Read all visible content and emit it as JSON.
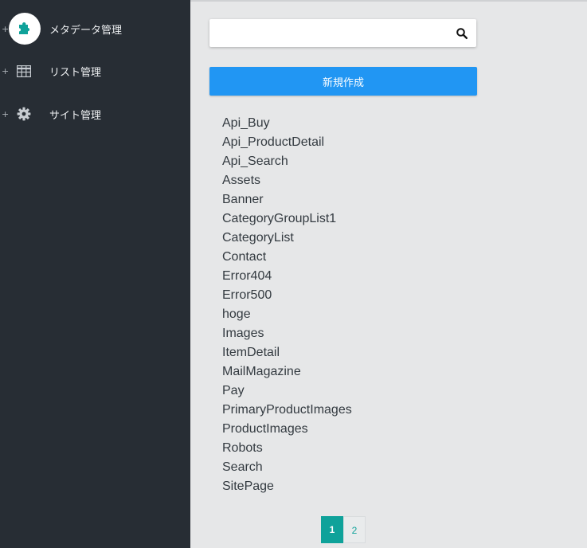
{
  "colors": {
    "sidebar_bg": "#272d34",
    "main_bg": "#e6e7e8",
    "accent_teal": "#0fa29a",
    "button_blue": "#2196f3"
  },
  "sidebar": {
    "items": [
      {
        "expander": "+",
        "icon": "puzzle-icon",
        "label": "メタデータ管理",
        "active": true
      },
      {
        "expander": "+",
        "icon": "table-icon",
        "label": "リスト管理",
        "active": false
      },
      {
        "expander": "+",
        "icon": "gear-icon",
        "label": "サイト管理",
        "active": false
      }
    ]
  },
  "search": {
    "value": "",
    "placeholder": "",
    "icon": "search-icon"
  },
  "new_button": {
    "label": "新規作成"
  },
  "items": [
    "Api_Buy",
    "Api_ProductDetail",
    "Api_Search",
    "Assets",
    "Banner",
    "CategoryGroupList1",
    "CategoryList",
    "Contact",
    "Error404",
    "Error500",
    "hoge",
    "Images",
    "ItemDetail",
    "MailMagazine",
    "Pay",
    "PrimaryProductImages",
    "ProductImages",
    "Robots",
    "Search",
    "SitePage"
  ],
  "pagination": {
    "pages": [
      "1",
      "2"
    ],
    "current": "1"
  }
}
